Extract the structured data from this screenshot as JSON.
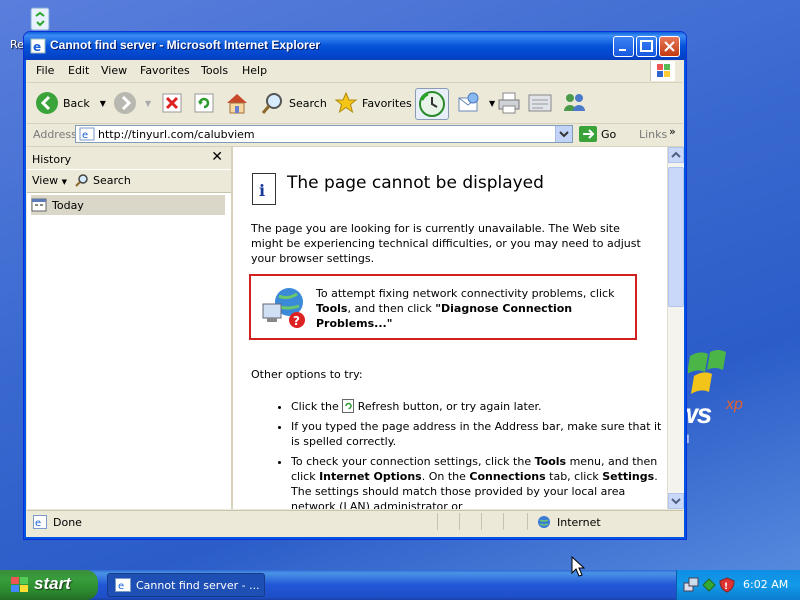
{
  "desktop": {
    "icon_label": "Re",
    "xp_text": "ws",
    "xp_sup": "xp",
    "xp_sub": "al"
  },
  "window": {
    "title": "Cannot find server - Microsoft Internet Explorer",
    "menu": [
      "File",
      "Edit",
      "View",
      "Favorites",
      "Tools",
      "Help"
    ],
    "toolbar": {
      "back": "Back",
      "search": "Search",
      "favorites": "Favorites"
    },
    "address": {
      "label": "Address",
      "url": "http://tinyurl.com/calubviem",
      "go": "Go",
      "links": "Links"
    },
    "history": {
      "title": "History",
      "view": "View",
      "search": "Search",
      "today": "Today"
    },
    "page": {
      "title": "The page cannot be displayed",
      "intro": "The page you are looking for is currently unavailable. The Web site might be experiencing technical difficulties, or you may need to adjust your browser settings.",
      "diagnose_pre": "To attempt fixing network connectivity problems, click ",
      "diagnose_tools": "Tools",
      "diagnose_mid": ", and then click ",
      "diagnose_link": "\"Diagnose Connection Problems...\"",
      "other_options": "Other options to try:",
      "bullet1_pre": "Click the ",
      "bullet1_post": " Refresh button, or try again later.",
      "bullet2": "If you typed the page address in the Address bar, make sure that it is spelled correctly.",
      "bullet3_a": "To check your connection settings, click the ",
      "bullet3_tools": "Tools",
      "bullet3_b": " menu, and then click ",
      "bullet3_io": "Internet Options",
      "bullet3_c": ". On the ",
      "bullet3_conn": "Connections",
      "bullet3_d": " tab, click ",
      "bullet3_settings": "Settings",
      "bullet3_e": ". The settings should match those provided by your local area network (LAN) administrator or"
    },
    "status": {
      "left": "Done",
      "zone": "Internet"
    }
  },
  "taskbar": {
    "start": "start",
    "task": "Cannot find server - ...",
    "clock": "6:02 AM"
  },
  "colors": {
    "titlebar": "#0553d8",
    "error_box": "#d02020",
    "start_green": "#379d3a"
  }
}
